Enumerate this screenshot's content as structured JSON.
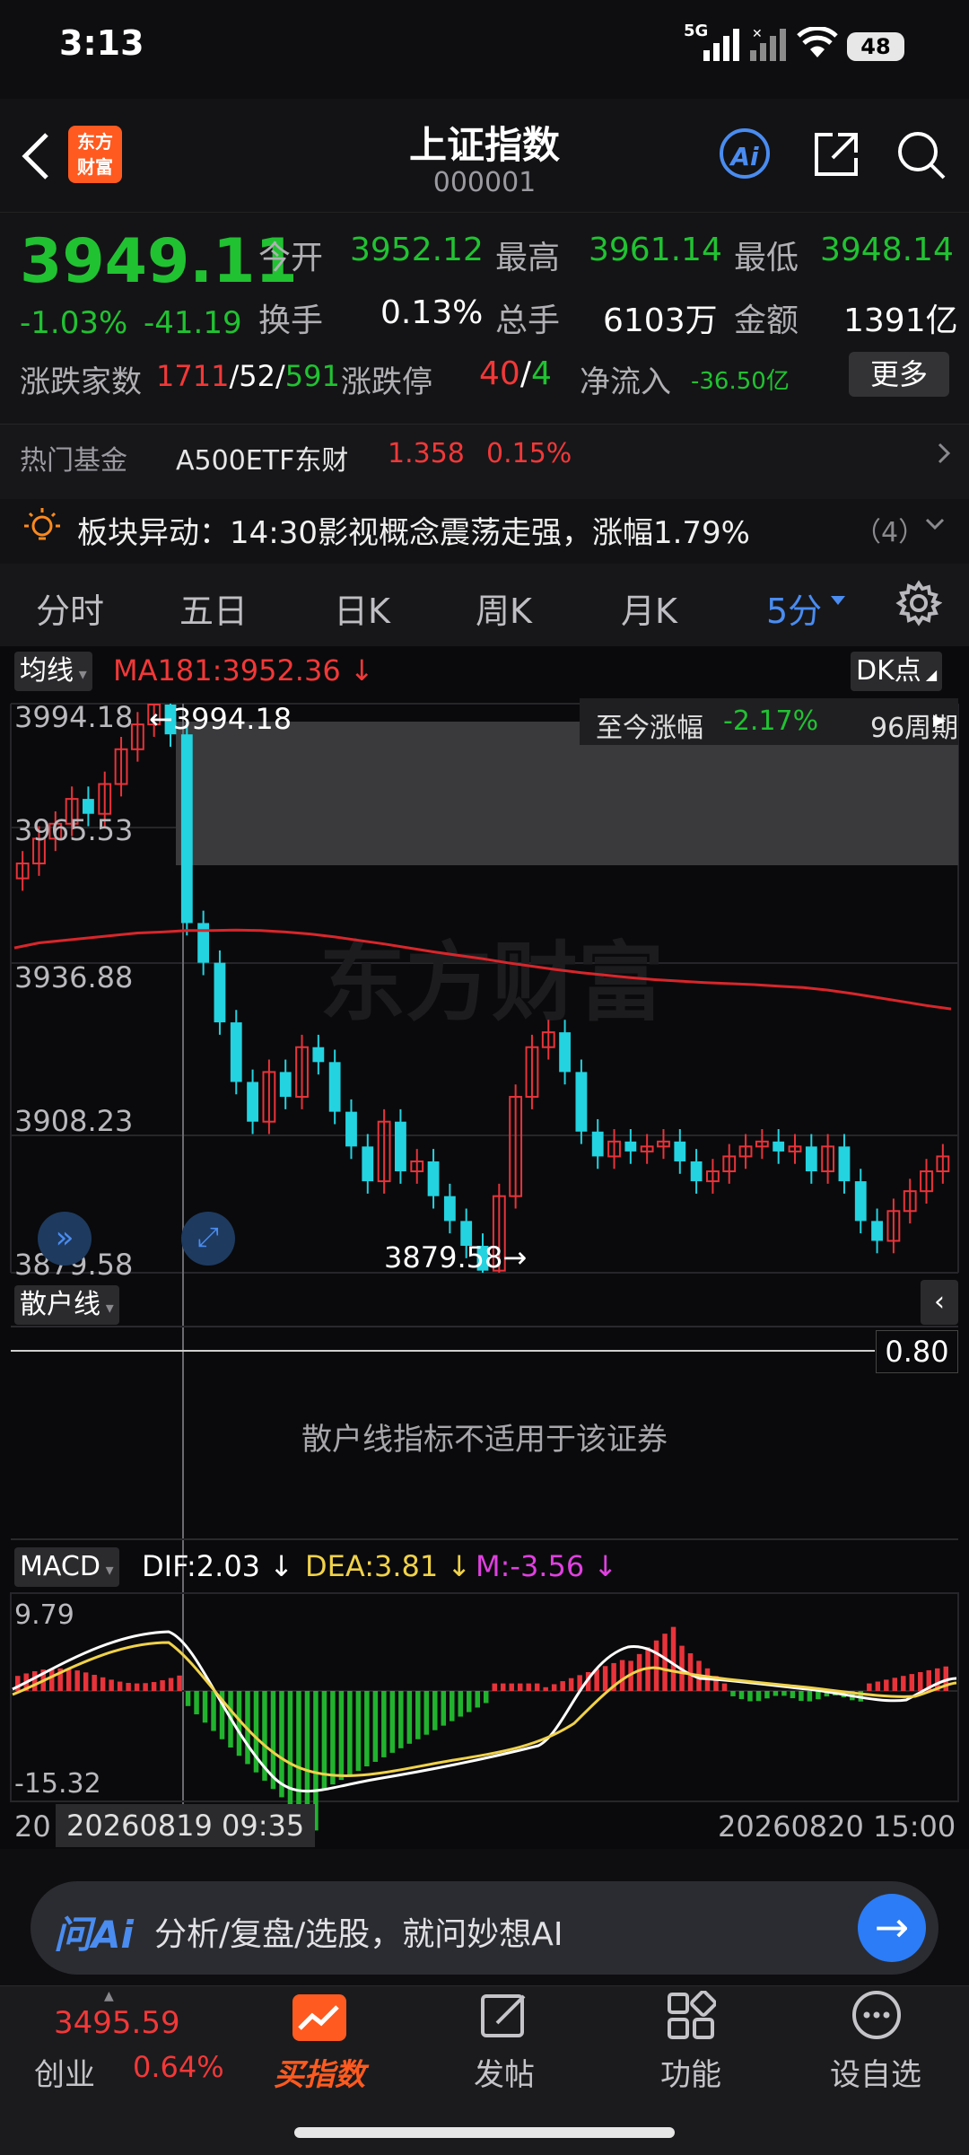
{
  "status": {
    "time": "3:13",
    "network": "5G",
    "battery": "48"
  },
  "header": {
    "logo_text": "东方\n财富",
    "title": "上证指数",
    "code": "000001",
    "ai_label": "Ai"
  },
  "quote": {
    "price": "3949.11",
    "change_pct": "-1.03%",
    "change": "-41.19",
    "open_label": "今开",
    "open": "3952.12",
    "high_label": "最高",
    "high": "3961.14",
    "low_label": "最低",
    "low": "3948.14",
    "turnover_label": "换手",
    "turnover": "0.13%",
    "volume_label": "总手",
    "volume": "6103万",
    "amount_label": "金额",
    "amount": "1391亿",
    "breadth_label": "涨跌家数",
    "breadth_up": "1711",
    "breadth_flat": "52",
    "breadth_down": "591",
    "limit_label": "涨跌停",
    "limit_up": "40",
    "limit_down": "4",
    "netflow_label": "净流入",
    "netflow": "-36.50亿",
    "more_label": "更多"
  },
  "fund": {
    "label": "热门基金",
    "name": "A500ETF东财",
    "price": "1.358",
    "change": "0.15%"
  },
  "alert": {
    "text": "板块异动：14:30影视概念震荡走强，涨幅1.79%",
    "count": "（4）"
  },
  "tabs": [
    "分时",
    "五日",
    "日K",
    "周K",
    "月K",
    "5分"
  ],
  "chart": {
    "ma_chip": "均线",
    "ma_text": "MA181:3952.36",
    "ma_arrow": "↓",
    "dk_chip": "DK点",
    "range_text": "至今涨幅",
    "range_pct": "-2.17%",
    "range_periods": "96周期",
    "high_marker": "←3994.18",
    "low_marker": "3879.58→",
    "watermark": "东方财富",
    "retail_chip": "散户线",
    "retail_value": "0.80",
    "retail_msg": "散户线指标不适用于该证券",
    "macd_chip": "MACD",
    "dif": "DIF:2.03",
    "dea": "DEA:3.81",
    "m": "M:-3.56",
    "macd_arrow": "↓",
    "cursor_date": "20260819 09:35",
    "end_date": "20260820 15:00",
    "start_date_partial": "20"
  },
  "chart_data": {
    "type": "candlestick",
    "interval": "5分",
    "y_ticks": [
      3994.18,
      3965.53,
      3936.88,
      3908.23,
      3879.58
    ],
    "ylim": [
      3879.58,
      3994.18
    ],
    "ma181": [
      3945,
      3946,
      3946.5,
      3947,
      3947.5,
      3948,
      3948.2,
      3948.5,
      3948.5,
      3948.6,
      3948.5,
      3948.2,
      3947.8,
      3947.2,
      3946.5,
      3945.8,
      3945,
      3944.2,
      3943.5,
      3942.8,
      3942,
      3941.3,
      3940.6,
      3940,
      3939.5,
      3939,
      3938.6,
      3938.3,
      3938,
      3937.8,
      3937.6,
      3937.3,
      3937,
      3936.5,
      3935.8,
      3935,
      3934.2,
      3933.4,
      3932.7
    ],
    "close": [
      3962,
      3967,
      3970,
      3975,
      3972,
      3978,
      3985,
      3990,
      3994,
      3988,
      3950,
      3942,
      3930,
      3918,
      3910,
      3920,
      3915,
      3925,
      3922,
      3912,
      3905,
      3898,
      3910,
      3900,
      3902,
      3895,
      3890,
      3885,
      3880,
      3895,
      3915,
      3925,
      3928,
      3920,
      3908,
      3903,
      3906,
      3904,
      3905,
      3906,
      3902,
      3898,
      3900,
      3903,
      3905,
      3906,
      3904,
      3905,
      3900,
      3905,
      3898,
      3890,
      3886,
      3892,
      3896,
      3900,
      3903
    ],
    "macd_ylim": [
      -15.32,
      9.79
    ],
    "dif_last": 2.03,
    "dea_last": 3.81,
    "m_last": -3.56
  },
  "ask": {
    "brand": "问Ai",
    "placeholder": "分析/复盘/选股，就问妙想AI"
  },
  "bottom_nav": {
    "index_value": "3495.59",
    "index_name": "创业",
    "index_change": "0.64%",
    "items": [
      "买指数",
      "发帖",
      "功能",
      "设自选"
    ]
  }
}
